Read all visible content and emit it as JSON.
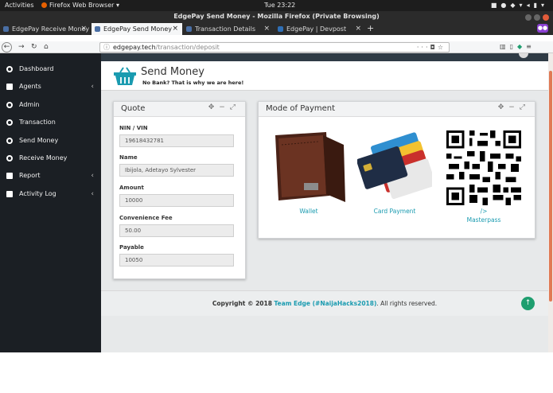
{
  "system": {
    "activities": "Activities",
    "app_menu": "Firefox Web Browser ▾",
    "clock": "Tue 23:22",
    "tray_icons": [
      "camera-icon",
      "skype-icon",
      "dropbox-icon",
      "wifi-icon",
      "volume-icon",
      "battery-icon",
      "power-icon"
    ]
  },
  "browser": {
    "window_title": "EdgePay Send Money - Mozilla Firefox (Private Browsing)",
    "tabs": [
      {
        "label": "EdgePay Receive Money",
        "active": false
      },
      {
        "label": "EdgePay Send Money",
        "active": true
      },
      {
        "label": "Transaction Details",
        "active": false
      },
      {
        "label": "EdgePay | Devpost",
        "active": false
      }
    ],
    "url_host": "edgepay.tech",
    "url_path": "/transaction/deposit"
  },
  "sidebar": {
    "items": [
      {
        "label": "Dashboard",
        "icon": "dashboard-icon",
        "chevron": false
      },
      {
        "label": "Agents",
        "icon": "users-icon",
        "chevron": true
      },
      {
        "label": "Admin",
        "icon": "user-icon",
        "chevron": false
      },
      {
        "label": "Transaction",
        "icon": "circle-icon",
        "chevron": false
      },
      {
        "label": "Send Money",
        "icon": "circle-icon",
        "chevron": false
      },
      {
        "label": "Receive Money",
        "icon": "circle-icon",
        "chevron": false
      },
      {
        "label": "Report",
        "icon": "file-icon",
        "chevron": true
      },
      {
        "label": "Activity Log",
        "icon": "list-icon",
        "chevron": true
      }
    ],
    "chevron_glyph": "‹"
  },
  "header": {
    "title": "Send Money",
    "subtitle": "No Bank? That is why we are here!"
  },
  "quote": {
    "title": "Quote",
    "fields": [
      {
        "label": "NIN / VIN",
        "value": "19618432781"
      },
      {
        "label": "Name",
        "value": "Ibijola, Adetayo Sylvester"
      },
      {
        "label": "Amount",
        "value": "10000"
      },
      {
        "label": "Convenience Fee",
        "value": "50.00"
      },
      {
        "label": "Payable",
        "value": "10050"
      }
    ]
  },
  "payment": {
    "title": "Mode of Payment",
    "options": [
      {
        "label": "Wallet"
      },
      {
        "label": "Card Payment"
      },
      {
        "label": "/>",
        "label2": "Masterpass"
      }
    ]
  },
  "footer": {
    "prefix": "Copyright © 2018",
    "team": "Team Edge (#NaijaHacks2018)",
    "suffix": ". All rights reserved."
  },
  "colors": {
    "sidebar_bg": "#1b1f24",
    "accent_link": "#1a9bb0",
    "basket": "#1a9bb0",
    "scroll_to_top": "#1e9e6f"
  }
}
